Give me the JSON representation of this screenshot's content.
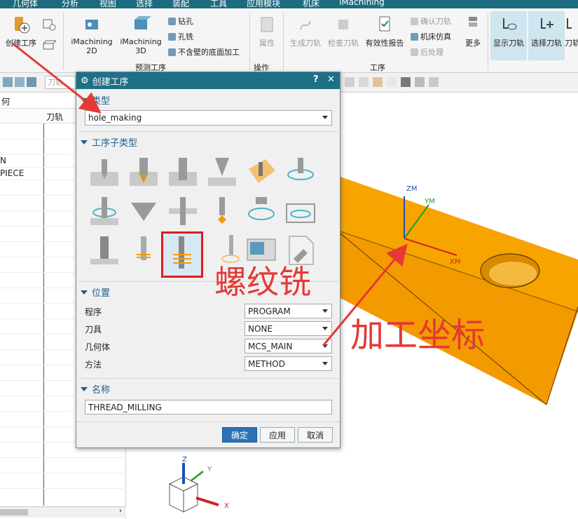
{
  "menubar": {
    "items": [
      "几何体",
      "分析",
      "视图",
      "选择",
      "装配",
      "工具",
      "应用模块",
      "机床",
      "iMachining"
    ]
  },
  "ribbon": {
    "create_op": "创建工序",
    "imachining2d_line1": "iMachining",
    "imachining2d_line2": "2D",
    "imachining3d_line1": "iMachining",
    "imachining3d_line2": "3D",
    "drill": "钻孔",
    "hole_mill": "孔铣",
    "floor_wall": "不含壁的底面加工",
    "group_predefined": "预测工序",
    "property": "属性",
    "group_operation": "操作",
    "gen_toolpath": "生成刀轨",
    "check_toolpath": "检查刀轨",
    "validity_report": "有效性报告",
    "confirm_toolpath": "确认刀轨",
    "machine_sim": "机床仿真",
    "postprocess": "后处理",
    "more": "更多",
    "group_process": "工序",
    "show_toolpath": "显示刀轨",
    "select_toolpath": "选择刀轨",
    "toolpath_cut": "刀轨"
  },
  "toolbar2": {
    "filter_placeholder": "刀轨"
  },
  "left_panel": {
    "header_col1": "何",
    "col_toolpath": "刀轨",
    "rows": [
      "N",
      "PIECE"
    ]
  },
  "dialog": {
    "title": "创建工序",
    "help": "?",
    "close": "✕",
    "section_type": "类型",
    "type_value": "hole_making",
    "section_subtype": "工序子类型",
    "section_location": "位置",
    "location_fields": [
      {
        "label": "程序",
        "value": "PROGRAM"
      },
      {
        "label": "刀具",
        "value": "NONE"
      },
      {
        "label": "几何体",
        "value": "MCS_MAIN"
      },
      {
        "label": "方法",
        "value": "METHOD"
      }
    ],
    "section_name": "名称",
    "name_value": "THREAD_MILLING",
    "ok": "确定",
    "apply": "应用",
    "cancel": "取消"
  },
  "viewport": {
    "axis_zm": "ZM",
    "axis_ym": "YM",
    "axis_xm": "XM",
    "triad_z": "Z",
    "triad_y": "Y",
    "triad_x": "X"
  },
  "annotations": {
    "thread_mill": "螺纹铣",
    "machining_coord": "加工坐标"
  },
  "colors": {
    "block_top": "#f7a400",
    "block_front": "#f39a00",
    "annotation_red": "#e53935",
    "title_bar": "#1f6f86",
    "selected_icon_border": "#e01b1b"
  }
}
